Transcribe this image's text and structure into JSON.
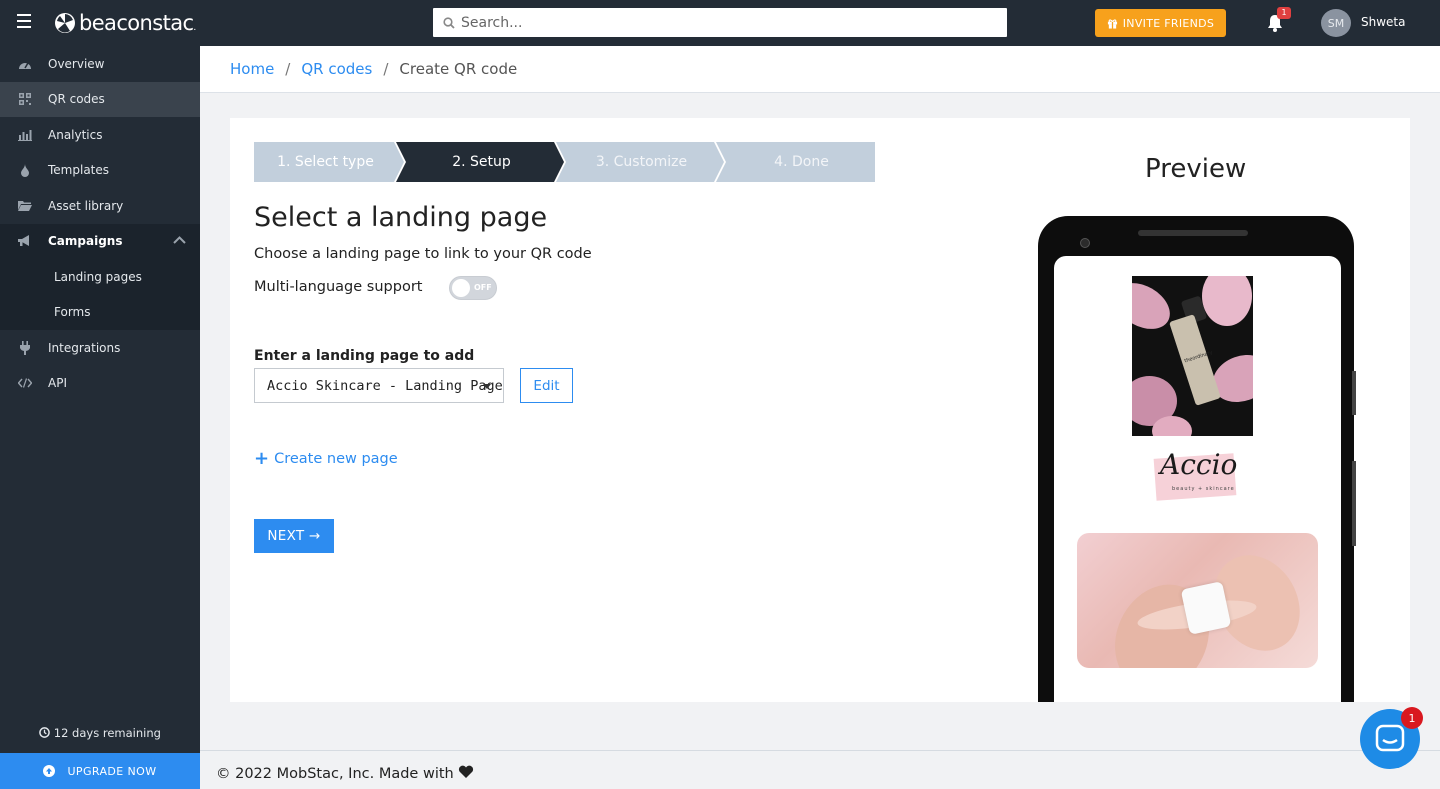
{
  "app": {
    "logo_text": "beaconstac",
    "logo_suffix": "."
  },
  "header": {
    "search_placeholder": "Search...",
    "invite_label": "INVITE FRIENDS",
    "notifications_count": "1",
    "avatar_initials": "SM",
    "username": "Shweta"
  },
  "sidebar": {
    "items": [
      {
        "label": "Overview",
        "icon": "dashboard-icon"
      },
      {
        "label": "QR codes",
        "icon": "qr-code-icon"
      },
      {
        "label": "Analytics",
        "icon": "bar-chart-icon"
      },
      {
        "label": "Templates",
        "icon": "drop-icon"
      },
      {
        "label": "Asset library",
        "icon": "folder-icon"
      },
      {
        "label": "Campaigns",
        "icon": "megaphone-icon"
      },
      {
        "label": "Landing pages"
      },
      {
        "label": "Forms"
      },
      {
        "label": "Integrations",
        "icon": "plug-icon"
      },
      {
        "label": "API",
        "icon": "code-icon"
      }
    ],
    "trial_remaining": "12 days remaining",
    "upgrade_label": "UPGRADE NOW"
  },
  "breadcrumb": {
    "home": "Home",
    "qr_codes": "QR codes",
    "current": "Create QR code"
  },
  "steps": [
    {
      "label": "1. Select type",
      "state": "done"
    },
    {
      "label": "2. Setup",
      "state": "active"
    },
    {
      "label": "3. Customize",
      "state": "pending"
    },
    {
      "label": "4. Done",
      "state": "pending"
    }
  ],
  "form": {
    "title": "Select a landing page",
    "subtitle": "Choose a landing page to link to your QR code",
    "multilang_label": "Multi-language support",
    "toggle_state": "OFF",
    "enter_label": "Enter a landing page to add",
    "selected_page": "Accio Skincare - Landing Page",
    "edit_label": "Edit",
    "create_label": "Create new page",
    "next_label": "NEXT"
  },
  "preview": {
    "title": "Preview",
    "brand": "Accio",
    "brand_sub": "beauty + skincare",
    "bottle_label": "theordinary"
  },
  "footer": {
    "text": "© 2022 MobStac, Inc. Made with"
  },
  "chat": {
    "badge": "1"
  },
  "colors": {
    "accent": "#2d8cf0",
    "sidebar": "#232c36",
    "invite": "#f7a11c",
    "step_active": "#232c36",
    "step_inactive": "#c2cfdc"
  }
}
